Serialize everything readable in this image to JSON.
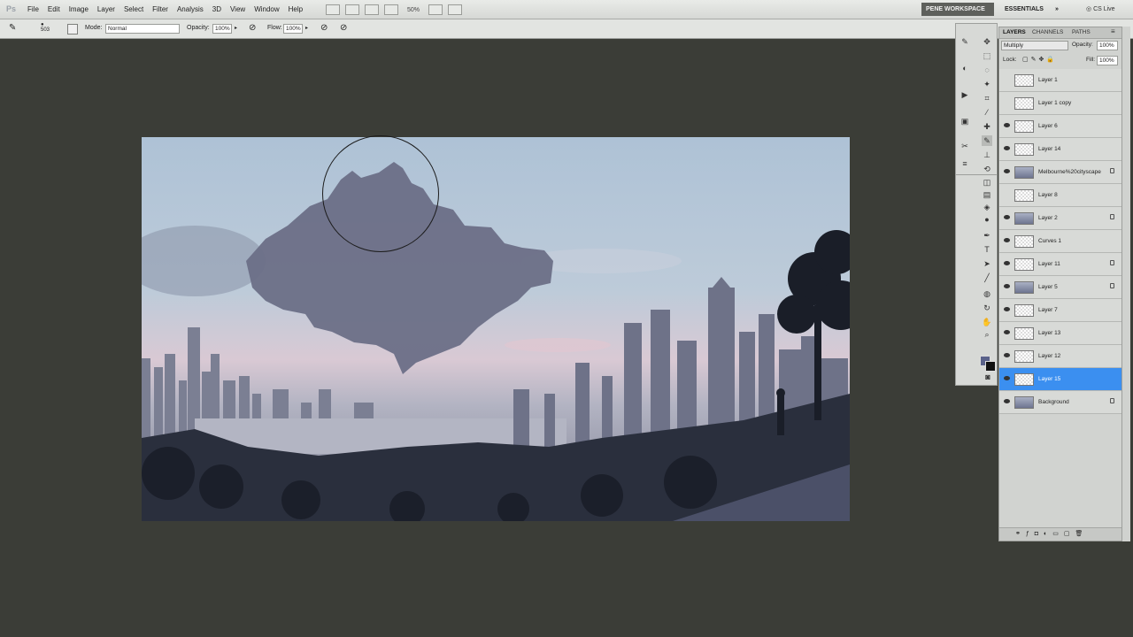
{
  "app": {
    "logo": "Ps"
  },
  "menu": [
    "File",
    "Edit",
    "Image",
    "Layer",
    "Select",
    "Filter",
    "Analysis",
    "3D",
    "View",
    "Window",
    "Help"
  ],
  "menubar": {
    "zoom": "50%"
  },
  "workspace": {
    "active": "PENE WORKSPACE",
    "essentials": "ESSENTIALS",
    "more": "»",
    "cslive": "CS Live"
  },
  "options": {
    "brush_size": "503",
    "mode_label": "Mode:",
    "mode_value": "Normal",
    "opacity_label": "Opacity:",
    "opacity_value": "100%",
    "flow_label": "Flow:",
    "flow_value": "100%"
  },
  "layers_panel": {
    "tabs": [
      "LAYERS",
      "CHANNELS",
      "PATHS"
    ],
    "blend_mode": "Multiply",
    "opacity_label": "Opacity:",
    "opacity_value": "100%",
    "lock_label": "Lock:",
    "fill_label": "Fill:",
    "fill_value": "100%",
    "layers": [
      {
        "name": "Layer 1",
        "visible": false,
        "locked": false,
        "selected": false,
        "thumb": "chk"
      },
      {
        "name": "Layer 1 copy",
        "visible": false,
        "locked": false,
        "selected": false,
        "thumb": "chk"
      },
      {
        "name": "Layer 6",
        "visible": true,
        "locked": false,
        "selected": false,
        "thumb": "chk"
      },
      {
        "name": "Layer 14",
        "visible": true,
        "locked": false,
        "selected": false,
        "thumb": "chk"
      },
      {
        "name": "Melbourne%20cityscape",
        "visible": true,
        "locked": true,
        "selected": false,
        "thumb": "dark"
      },
      {
        "name": "Layer 8",
        "visible": false,
        "locked": false,
        "selected": false,
        "thumb": "chk"
      },
      {
        "name": "Layer 2",
        "visible": true,
        "locked": true,
        "selected": false,
        "thumb": "dark"
      },
      {
        "name": "Curves 1",
        "visible": true,
        "locked": false,
        "selected": false,
        "thumb": "chk"
      },
      {
        "name": "Layer 11",
        "visible": true,
        "locked": true,
        "selected": false,
        "thumb": "chk"
      },
      {
        "name": "Layer 5",
        "visible": true,
        "locked": true,
        "selected": false,
        "thumb": "dark"
      },
      {
        "name": "Layer 7",
        "visible": true,
        "locked": false,
        "selected": false,
        "thumb": "chk"
      },
      {
        "name": "Layer 13",
        "visible": true,
        "locked": false,
        "selected": false,
        "thumb": "chk"
      },
      {
        "name": "Layer 12",
        "visible": true,
        "locked": false,
        "selected": false,
        "thumb": "chk"
      },
      {
        "name": "Layer 15",
        "visible": true,
        "locked": false,
        "selected": true,
        "thumb": "chk"
      },
      {
        "name": "Background",
        "visible": true,
        "locked": true,
        "selected": false,
        "thumb": "dark"
      }
    ]
  },
  "colors": {
    "accent": "#3b8ff0",
    "workspace_bg": "#3b3d37",
    "foreground_swatch": "#5a628a",
    "background_swatch": "#111111"
  }
}
